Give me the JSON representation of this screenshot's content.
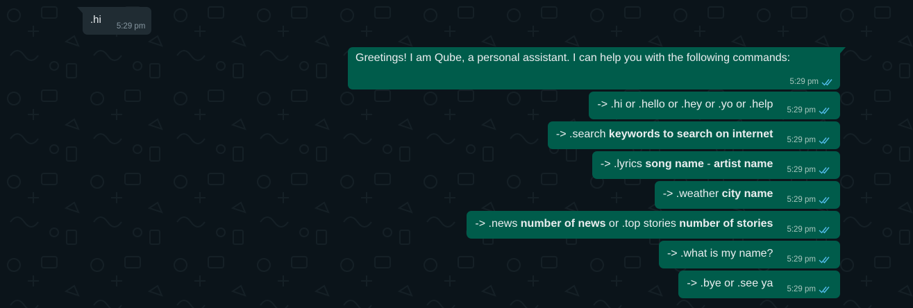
{
  "incoming": {
    "text": ".hi",
    "time": "5:29 pm"
  },
  "outgoing": [
    {
      "segments": [
        {
          "t": "Greetings! I am Qube, a personal assistant. I can help you with the following commands:",
          "b": false
        }
      ],
      "time": "5:29 pm"
    },
    {
      "segments": [
        {
          "t": "-> .hi or .hello or .hey or .yo or .help",
          "b": false
        }
      ],
      "time": "5:29 pm"
    },
    {
      "segments": [
        {
          "t": "-> .search ",
          "b": false
        },
        {
          "t": "keywords to search on internet",
          "b": true
        }
      ],
      "time": "5:29 pm"
    },
    {
      "segments": [
        {
          "t": "-> .lyrics ",
          "b": false
        },
        {
          "t": "song name",
          "b": true
        },
        {
          "t": " - ",
          "b": false
        },
        {
          "t": "artist name",
          "b": true
        }
      ],
      "time": "5:29 pm"
    },
    {
      "segments": [
        {
          "t": "-> .weather ",
          "b": false
        },
        {
          "t": "city name",
          "b": true
        }
      ],
      "time": "5:29 pm"
    },
    {
      "segments": [
        {
          "t": "-> .news ",
          "b": false
        },
        {
          "t": "number of news",
          "b": true
        },
        {
          "t": " or .top stories ",
          "b": false
        },
        {
          "t": "number of stories",
          "b": true
        }
      ],
      "time": "5:29 pm"
    },
    {
      "segments": [
        {
          "t": "-> .what is my name?",
          "b": false
        }
      ],
      "time": "5:29 pm"
    },
    {
      "segments": [
        {
          "t": "-> .bye or .see ya",
          "b": false
        }
      ],
      "time": "5:29 pm"
    }
  ],
  "colors": {
    "background": "#0b141a",
    "incoming_bubble": "#202c33",
    "outgoing_bubble": "#005c4b",
    "read_ticks": "#53bdeb"
  },
  "icons": {
    "read_receipt": "double-check-icon"
  }
}
